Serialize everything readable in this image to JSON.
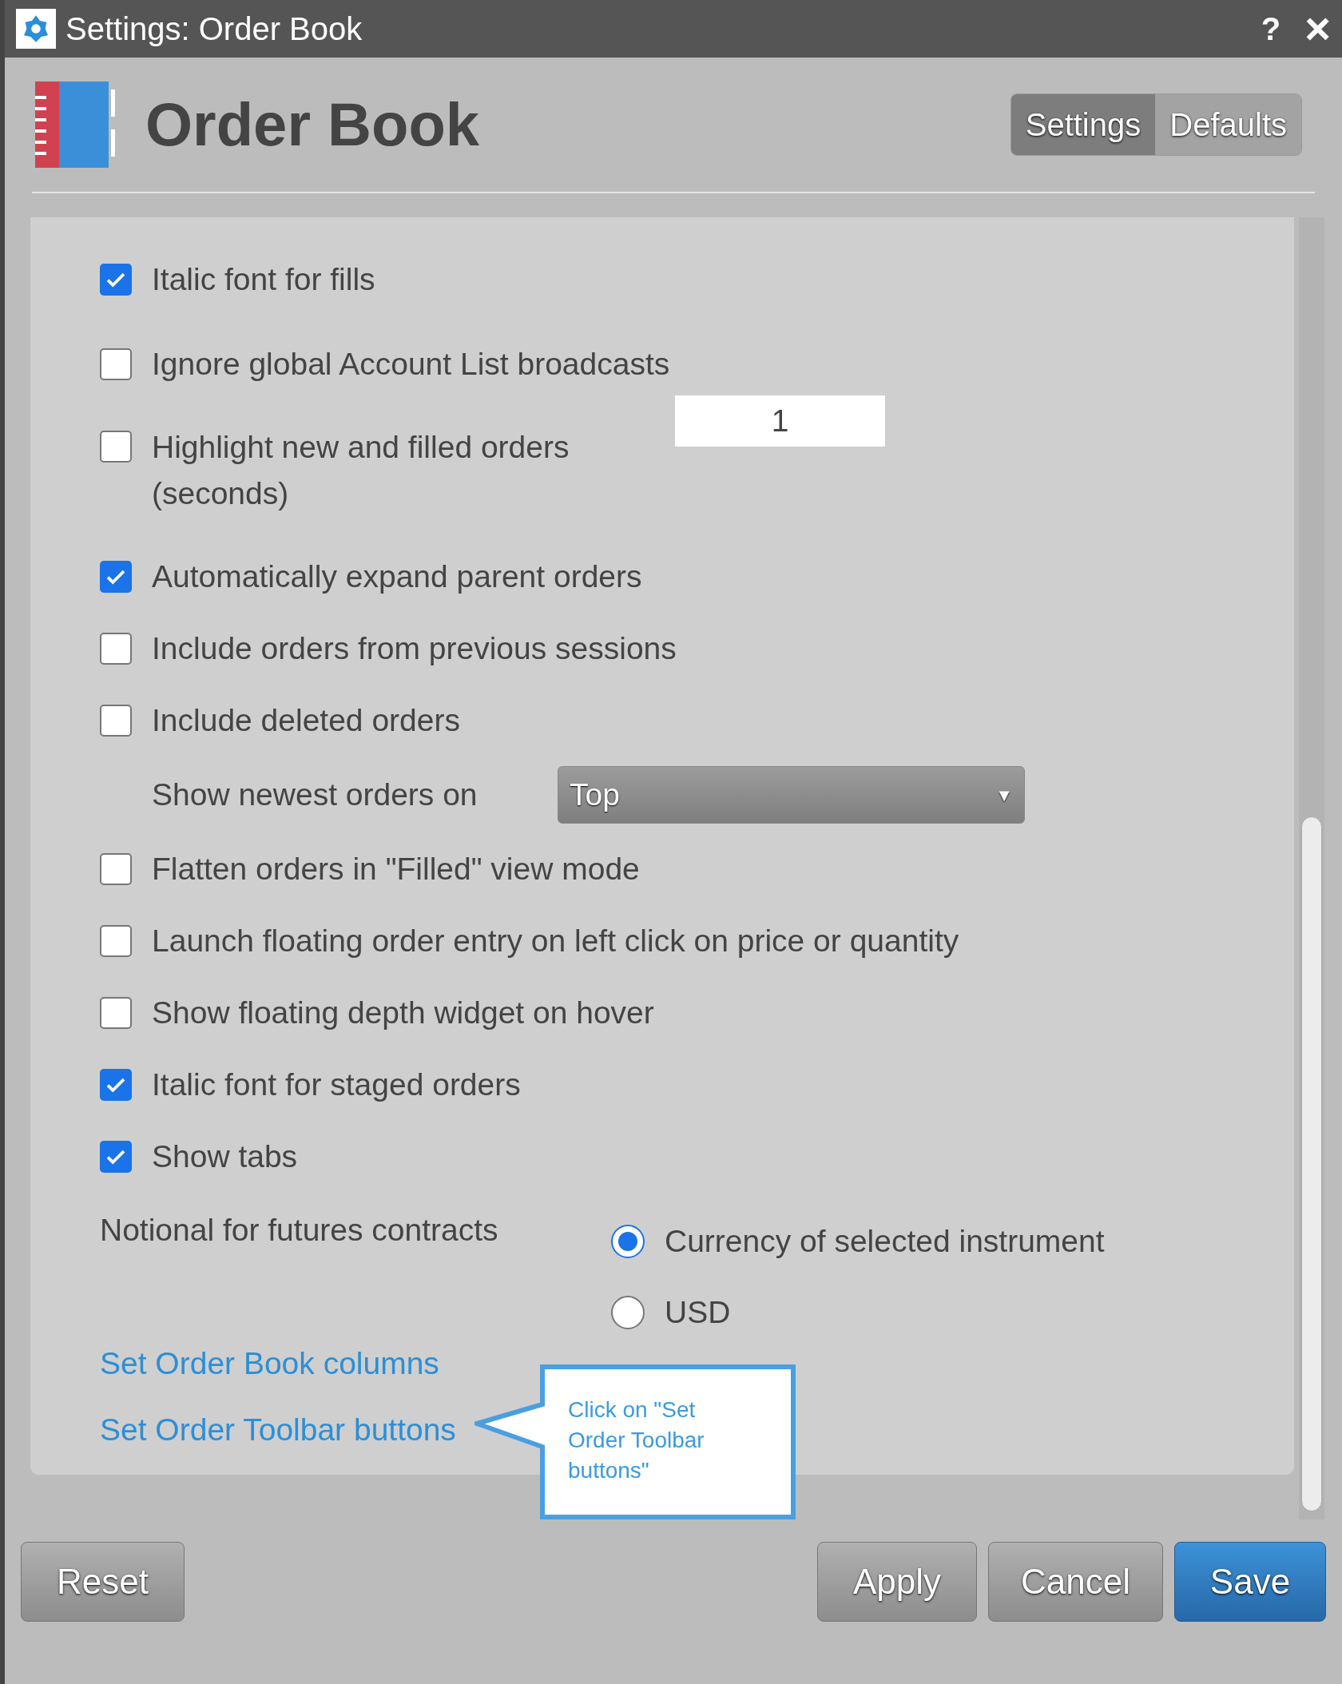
{
  "window": {
    "title": "Settings: Order Book",
    "help": "?",
    "close": "×"
  },
  "header": {
    "title": "Order Book",
    "tabs": [
      {
        "label": "Settings",
        "selected": true
      },
      {
        "label": "Defaults",
        "selected": false
      }
    ]
  },
  "options": [
    {
      "kind": "checkbox",
      "label": "Italic font for fills",
      "checked": true
    },
    {
      "kind": "checkbox",
      "label": "Ignore global Account List broadcasts",
      "checked": false
    },
    {
      "kind": "checkbox_field",
      "label": "Highlight new and filled orders (seconds)",
      "checked": false,
      "value": "1"
    },
    {
      "kind": "checkbox",
      "label": "Automatically expand parent orders",
      "checked": true
    },
    {
      "kind": "checkbox",
      "label": "Include orders from previous sessions",
      "checked": false
    },
    {
      "kind": "checkbox",
      "label": "Include deleted orders",
      "checked": false
    },
    {
      "kind": "select",
      "label": "Show newest orders on",
      "value": "Top",
      "caret": "▼"
    },
    {
      "kind": "checkbox",
      "label": "Flatten orders in \"Filled\" view mode",
      "checked": false
    },
    {
      "kind": "checkbox",
      "label": "Launch floating order entry on left click on price or quantity",
      "checked": false
    },
    {
      "kind": "checkbox",
      "label": "Show floating depth widget on hover",
      "checked": false
    },
    {
      "kind": "checkbox",
      "label": "Italic font for staged orders",
      "checked": true
    },
    {
      "kind": "checkbox",
      "label": "Show tabs",
      "checked": true
    },
    {
      "kind": "radio",
      "label": "Notional for futures contracts",
      "choices": [
        {
          "label": "Currency of selected instrument",
          "selected": true
        },
        {
          "label": "USD",
          "selected": false
        }
      ]
    }
  ],
  "links": [
    "Set Order Book columns",
    "Set Order Toolbar buttons"
  ],
  "callout": "Click on \"Set Order Toolbar buttons\"",
  "buttons": {
    "left": [
      "Reset"
    ],
    "right": [
      {
        "label": "Apply",
        "primary": false
      },
      {
        "label": "Cancel",
        "primary": false
      },
      {
        "label": "Save",
        "primary": true
      }
    ]
  }
}
